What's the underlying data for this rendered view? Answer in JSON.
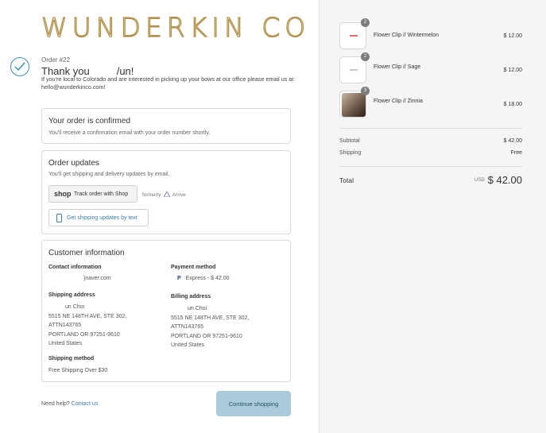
{
  "brand": {
    "logo_text": "WUNDERKIN CO",
    "accent": "#b3904a"
  },
  "header": {
    "order_number": "Order #22",
    "thanks_prefix": "Thank you",
    "thanks_suffix": "/un!",
    "notice": "If you're local to Colorado and are interested in picking up your bows at our office please email us at hello@wunderkinco.com!"
  },
  "confirmed": {
    "title": "Your order is confirmed",
    "subtitle": "You'll receive a confirmation email with your order number shortly."
  },
  "updates": {
    "title": "Order updates",
    "subtitle": "You'll get shipping and delivery updates by email.",
    "shop_logo": "shop",
    "shop_button": "Track order with Shop",
    "formerly": "formerly",
    "arrive": "Arrive",
    "text_button": "Get shipping updates by text"
  },
  "customer": {
    "title": "Customer information",
    "contact_label": "Contact information",
    "contact_value": "}naver.com",
    "payment_label": "Payment method",
    "payment_icon": "P",
    "payment_value": "Express - $ 42.00",
    "shipping_label": "Shipping address",
    "shipping_lines": [
      "un Choi",
      "5515 NE 148TH AVE, STE 302,",
      "ATTN143765",
      "PORTLAND OR 97251-9610",
      "United States"
    ],
    "billing_label": "Billing address",
    "billing_lines": [
      "un Choi",
      "5515 NE 148TH AVE, STE 302,",
      "ATTN143765",
      "PORTLAND OR 97251-9610",
      "United States"
    ],
    "method_label": "Shipping method",
    "method_value": "Free Shipping Over $30"
  },
  "footer": {
    "help_text": "Need help?",
    "contact_link": "Contact us",
    "continue_button": "Continue shopping"
  },
  "cart": {
    "items": [
      {
        "name": "Flower Clip // Wintermelon",
        "qty": "2",
        "price": "$ 12.00",
        "clip_color": "#e26a6a"
      },
      {
        "name": "Flower Clip // Sage",
        "qty": "2",
        "price": "$ 12.00",
        "clip_color": "#c8c8c8"
      },
      {
        "name": "Flower Clip // Zinnia",
        "qty": "3",
        "price": "$ 18.00",
        "clip_color": ""
      }
    ],
    "subtotal_label": "Subtotal",
    "subtotal_value": "$ 42.00",
    "shipping_label": "Shipping",
    "shipping_value": "Free",
    "total_label": "Total",
    "currency": "USD",
    "total_value": "$ 42.00"
  }
}
